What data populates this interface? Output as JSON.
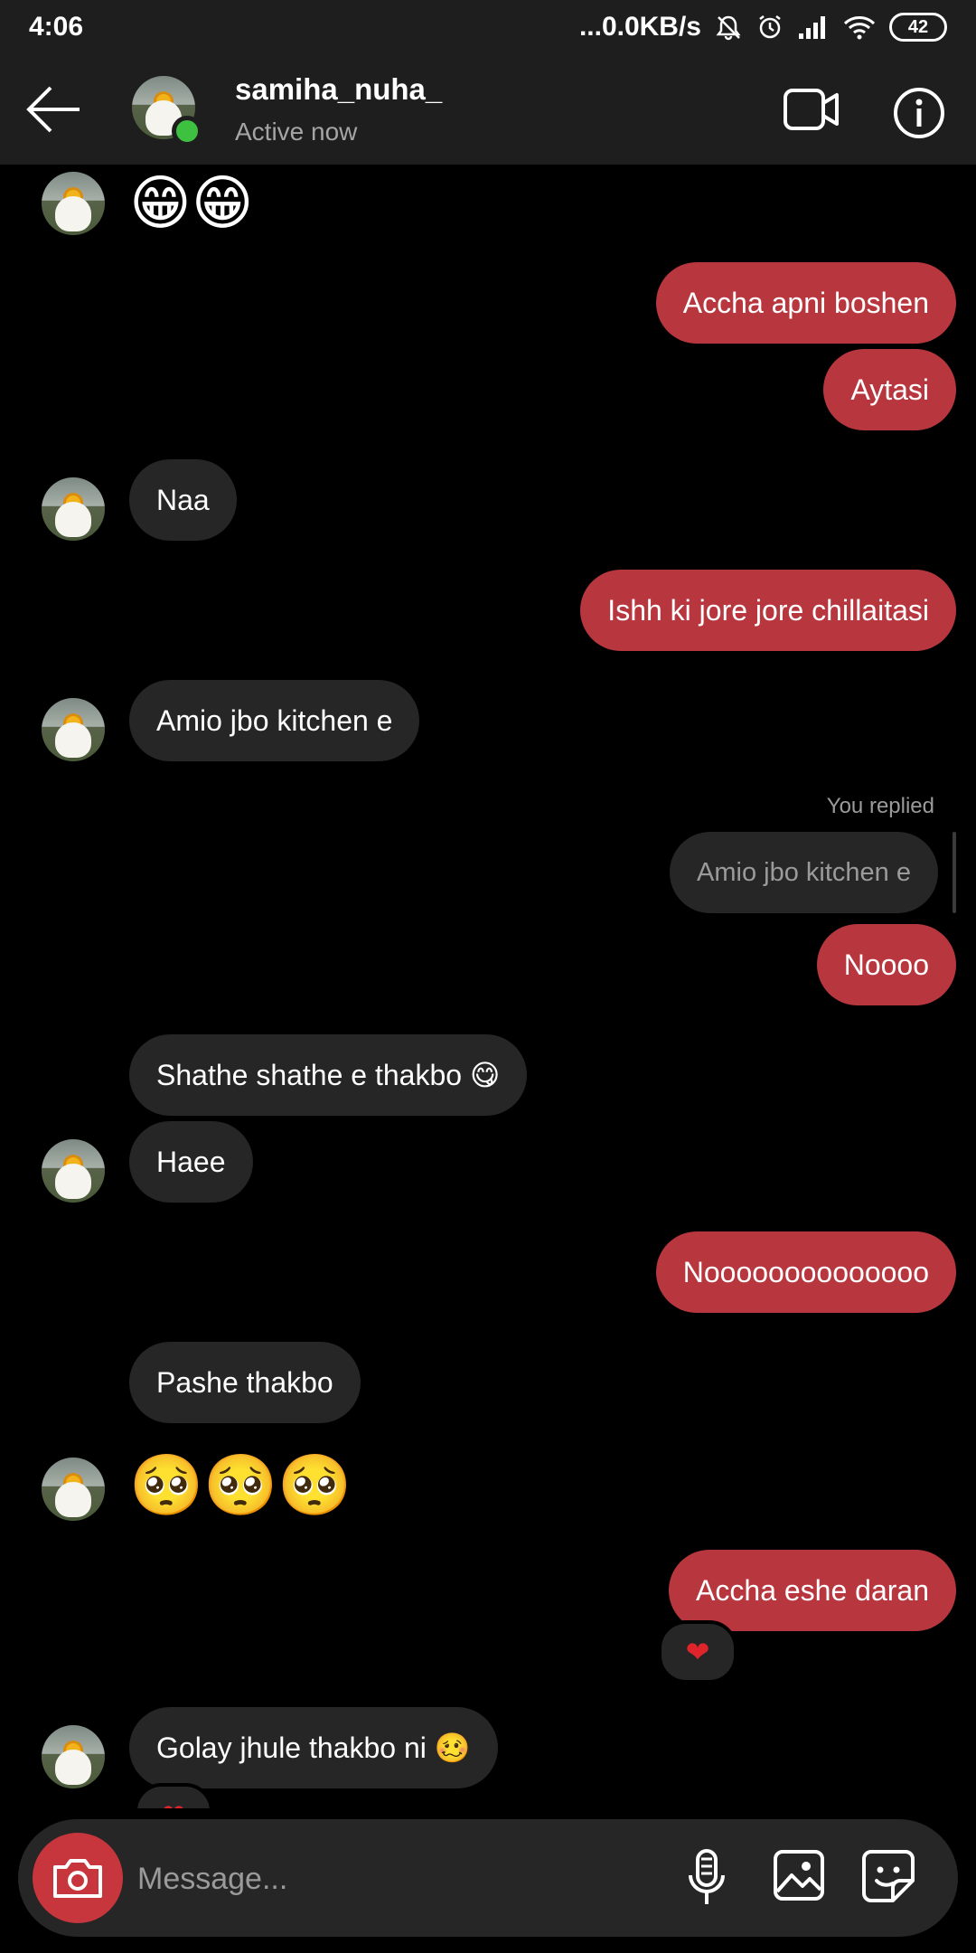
{
  "status_bar": {
    "time": "4:06",
    "network_speed": "...0.0KB/s",
    "battery": "42",
    "icons": [
      "mute-bell-icon",
      "alarm-icon",
      "signal-icon",
      "wifi-icon"
    ]
  },
  "header": {
    "username": "samiha_nuha_",
    "status": "Active now",
    "icons": [
      "back-arrow-icon",
      "video-call-icon",
      "info-icon"
    ]
  },
  "messages": [
    {
      "text": "Accha apni boshen"
    },
    {
      "text": "Aytasi"
    },
    {
      "text": "Naa"
    },
    {
      "text": "Ishh ki jore jore chillaitasi"
    },
    {
      "text": "Amio jbo kitchen e"
    },
    {
      "text": "Amio jbo kitchen e"
    },
    {
      "text": "Noooo"
    },
    {
      "text": "Shathe shathe e thakbo 😋"
    },
    {
      "text": "Haee"
    },
    {
      "text": "Noooooooooooooo"
    },
    {
      "text": "Pashe thakbo"
    },
    {
      "text": "Accha eshe daran"
    },
    {
      "text": "Golay jhule thakbo ni 🥴"
    }
  ],
  "emoji_rows": {
    "top": "😁😁",
    "pleading": "🥺🥺🥺"
  },
  "reply_label": "You replied",
  "reaction": "❤",
  "composer": {
    "placeholder": "Message...",
    "icons": [
      "camera-icon",
      "microphone-icon",
      "gallery-icon",
      "sticker-icon"
    ]
  },
  "colors": {
    "outgoing_bubble": "#b8373f",
    "incoming_bubble": "#262626",
    "header_bg": "#1e1e1e",
    "online_dot": "#3ec140"
  }
}
